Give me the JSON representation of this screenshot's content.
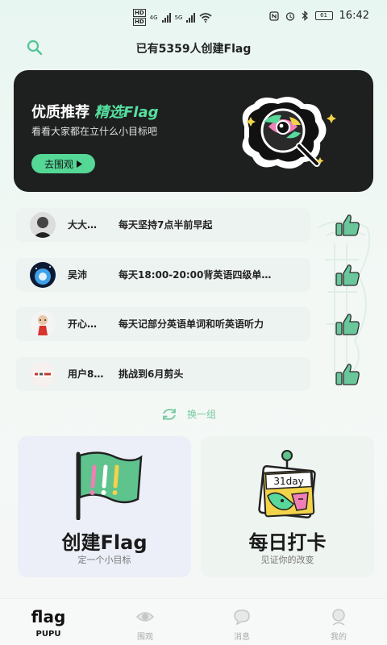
{
  "status_bar": {
    "network_1": "HD",
    "network_2": "HD",
    "net_4g": "4G",
    "net_5g": "5G",
    "battery": "61",
    "time": "16:42"
  },
  "header": {
    "title": "已有5359人创建Flag",
    "search_icon": "search-icon"
  },
  "banner": {
    "title": "优质推荐",
    "title_accent": "精选Flag",
    "subtitle": "看看大家都在立什么小目标吧",
    "button_label": "去围观"
  },
  "flags": [
    {
      "user": "大大…",
      "goal": "每天坚持7点半前早起"
    },
    {
      "user": "吴沛",
      "goal": "每天18:00-20:00背英语四级单…"
    },
    {
      "user": "开心…",
      "goal": "每天记部分英语单词和听英语听力"
    },
    {
      "user": "用户8…",
      "goal": "挑战到6月剪头"
    }
  ],
  "refresh_label": "换一组",
  "cards": {
    "create": {
      "title": "创建Flag",
      "subtitle": "定一个小目标"
    },
    "checkin": {
      "title": "每日打卡",
      "subtitle": "见证你的改变",
      "calendar_text": "31day"
    }
  },
  "bottom_nav": {
    "logo": "flag",
    "home_label": "PUPU",
    "watch_label": "围观",
    "messages_label": "消息",
    "mine_label": "我的"
  },
  "colors": {
    "accent": "#55d796",
    "banner_bg": "#1e1f1f",
    "row_bg": "#edf3f0"
  }
}
